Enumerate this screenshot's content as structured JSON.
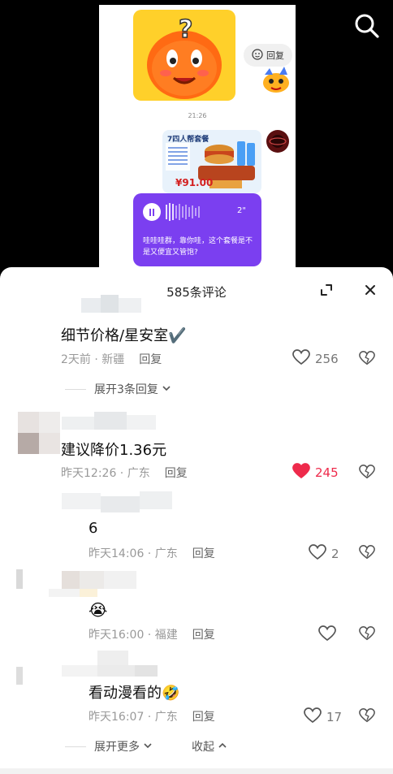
{
  "video": {
    "chat_time": "21:26",
    "reply_chip": "回复",
    "ad_title": "7四人帮套餐",
    "ad_price": "¥91.00",
    "voice_duration": "2\"",
    "voice_text": "哇哇哇群，靠你哇，这个套餐是不是又便宜又管饱?"
  },
  "sheet": {
    "title": "585条评论"
  },
  "comments": [
    {
      "text": "细节价格/星安室✔️",
      "date": "2天前",
      "location": "新疆",
      "reply": "回复",
      "likes": "256",
      "liked": false,
      "expand": "展开3条回复"
    },
    {
      "text": "建议降价1.36元",
      "date": "昨天12:26",
      "location": "广东",
      "reply": "回复",
      "likes": "245",
      "liked": true
    },
    {
      "text": "6",
      "date": "昨天14:06",
      "location": "广东",
      "reply": "回复",
      "likes": "2",
      "liked": false
    },
    {
      "text": "😭",
      "date": "昨天16:00",
      "location": "福建",
      "reply": "回复",
      "likes": "",
      "liked": false
    },
    {
      "text": "看动漫看的🤣",
      "date": "昨天16:07",
      "location": "广东",
      "reply": "回复",
      "likes": "17",
      "liked": false
    }
  ],
  "footer": {
    "expand_more": "展开更多",
    "collapse": "收起"
  },
  "colors": {
    "liked_red": "#ee2a4b",
    "voice_purple": "#7b3ff0",
    "meta_gray": "#999999"
  },
  "icons": {
    "search": "search-icon",
    "expand": "expand-icon",
    "close": "close-icon",
    "heart": "heart-icon",
    "dislike": "broken-heart-icon",
    "chevron_down": "chevron-down-icon",
    "chevron_up": "chevron-up-icon"
  }
}
